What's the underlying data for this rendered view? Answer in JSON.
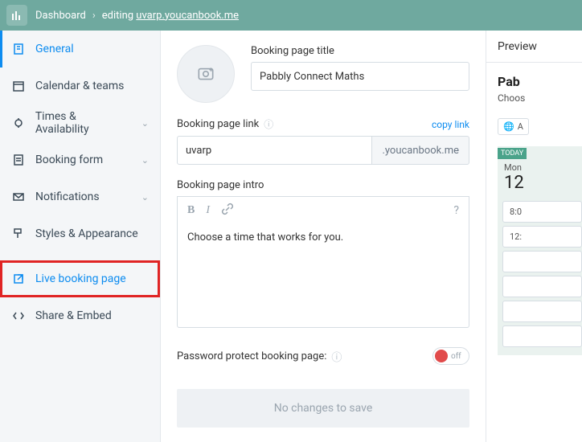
{
  "breadcrumb": {
    "root": "Dashboard",
    "action": "editing",
    "url": "uvarp.youcanbook.me"
  },
  "sidebar": {
    "items": [
      {
        "label": "General"
      },
      {
        "label": "Calendar & teams"
      },
      {
        "label": "Times & Availability"
      },
      {
        "label": "Booking form"
      },
      {
        "label": "Notifications"
      },
      {
        "label": "Styles & Appearance"
      },
      {
        "label": "Live booking page"
      },
      {
        "label": "Share & Embed"
      }
    ]
  },
  "form": {
    "title_label": "Booking page title",
    "title_value": "Pabbly Connect Maths",
    "link_label": "Booking page link",
    "copy_link": "copy link",
    "link_value": "uvarp",
    "link_suffix": ".youcanbook.me",
    "intro_label": "Booking page intro",
    "intro_value": "Choose a time that works for you.",
    "pw_label": "Password protect booking page:",
    "toggle_state": "off",
    "save_status": "No changes to save"
  },
  "preview": {
    "header": "Preview",
    "title": "Pab",
    "subtitle": "Choos",
    "lang": "A",
    "today": "TODAY",
    "day": "Mon",
    "date": "12",
    "slots": [
      "8:0",
      "12:",
      "",
      "",
      "",
      ""
    ]
  }
}
